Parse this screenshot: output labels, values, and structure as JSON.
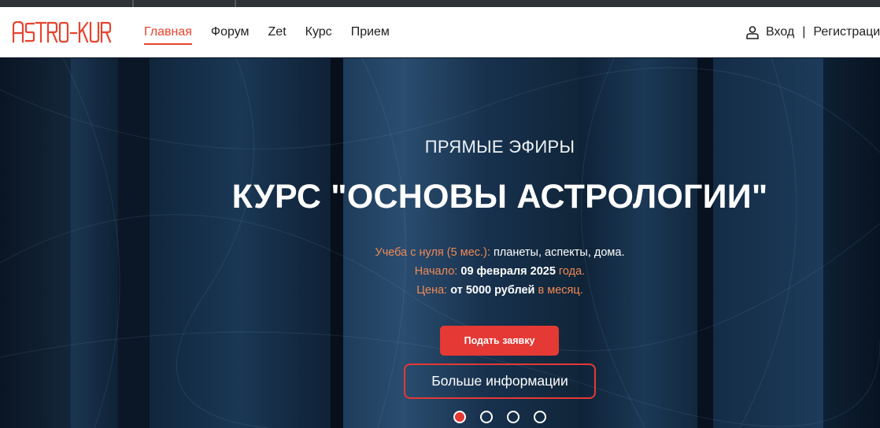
{
  "topbar": {},
  "header": {
    "logo_text": "ASTRO-KURS",
    "nav": [
      {
        "label": "Главная",
        "active": true
      },
      {
        "label": "Форум",
        "active": false
      },
      {
        "label": "Zet",
        "active": false
      },
      {
        "label": "Курс",
        "active": false
      },
      {
        "label": "Прием",
        "active": false
      }
    ],
    "auth": {
      "login_label": "Вход",
      "separator": "|",
      "register_label": "Регистрация",
      "icon": "user-icon"
    }
  },
  "hero": {
    "kicker": "ПРЯМЫЕ ЭФИРЫ",
    "title": "КУРС \"ОСНОВЫ АСТРОЛОГИИ\"",
    "lines": [
      {
        "label": "Учеба с нуля (5 мес.):",
        "value": "планеты, аспекты, дома.",
        "suffix": ""
      },
      {
        "label": "Начало:",
        "value": "09 февраля 2025",
        "suffix": "года."
      },
      {
        "label": "Цена:",
        "value": "от 5000 рублей",
        "suffix": "в месяц."
      }
    ],
    "primary_button": "Подать заявку",
    "secondary_button": "Больше информации",
    "slides_count": 4,
    "active_slide": 1
  },
  "colors": {
    "accent": "#e53935",
    "nav_active": "#e8432f",
    "info_label": "#f08a56",
    "header_bg": "#ffffff",
    "hero_bg": "#0e2236"
  }
}
